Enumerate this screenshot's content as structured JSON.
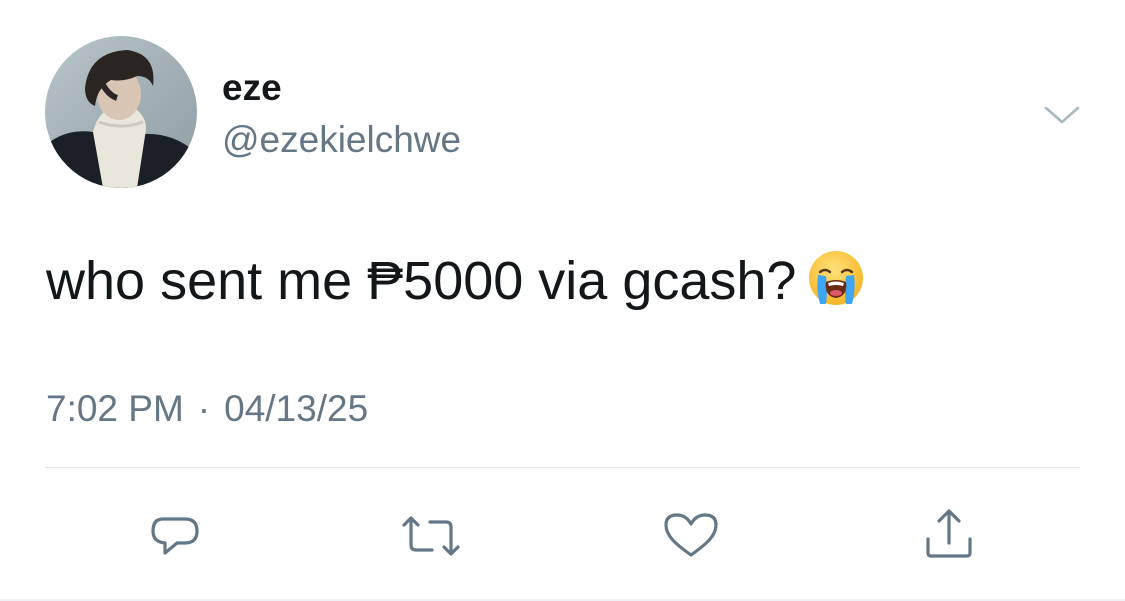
{
  "tweet": {
    "display_name": "eze",
    "handle": "@ezekielchwe",
    "text": "who sent me ₱5000 via gcash?",
    "emoji": "loudly-crying-face-emoji",
    "time": "7:02 PM",
    "separator": "·",
    "date": "04/13/25"
  },
  "icons": {
    "menu": "chevron-down-icon",
    "reply": "reply-icon",
    "retweet": "retweet-icon",
    "like": "heart-icon",
    "share": "share-icon"
  },
  "colors": {
    "text": "#14171a",
    "secondary_text": "#657786",
    "divider": "#e1e8ed",
    "icon": "#657786"
  }
}
